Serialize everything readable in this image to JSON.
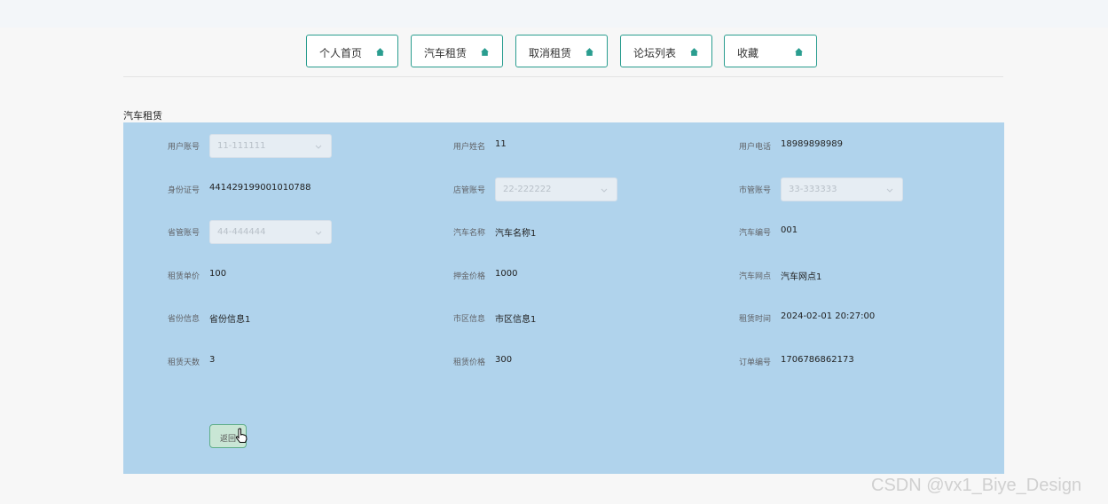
{
  "nav": {
    "items": [
      {
        "label": "个人首页"
      },
      {
        "label": "汽车租赁"
      },
      {
        "label": "取消租赁"
      },
      {
        "label": "论坛列表"
      },
      {
        "label": "收藏"
      }
    ]
  },
  "section_title": "汽车租赁",
  "form": {
    "user_account": {
      "label": "用户账号",
      "value": "11-111111"
    },
    "user_name": {
      "label": "用户姓名",
      "value": "11"
    },
    "user_phone": {
      "label": "用户电话",
      "value": "18989898989"
    },
    "id_number": {
      "label": "身份证号",
      "value": "441429199001010788"
    },
    "store_account": {
      "label": "店管账号",
      "value": "22-222222"
    },
    "city_account": {
      "label": "市管账号",
      "value": "33-333333"
    },
    "province_account": {
      "label": "省管账号",
      "value": "44-444444"
    },
    "car_name": {
      "label": "汽车名称",
      "value": "汽车名称1"
    },
    "car_number": {
      "label": "汽车编号",
      "value": "001"
    },
    "rent_unit_price": {
      "label": "租赁单价",
      "value": "100"
    },
    "deposit_price": {
      "label": "押金价格",
      "value": "1000"
    },
    "car_outlet": {
      "label": "汽车网点",
      "value": "汽车网点1"
    },
    "province_info": {
      "label": "省份信息",
      "value": "省份信息1"
    },
    "city_info": {
      "label": "市区信息",
      "value": "市区信息1"
    },
    "rent_time": {
      "label": "租赁时间",
      "value": "2024-02-01 20:27:00"
    },
    "rent_days": {
      "label": "租赁天数",
      "value": "3"
    },
    "rent_price": {
      "label": "租赁价格",
      "value": "300"
    },
    "order_number": {
      "label": "订单编号",
      "value": "1706786862173"
    }
  },
  "back_button": {
    "label": "返回"
  },
  "watermark": "CSDN @vx1_Biye_Design",
  "colors": {
    "panel": "#b0d3ec",
    "accent": "#2a9d8f",
    "background": "#f7f7f7"
  },
  "icons": {
    "nav": "home-icon",
    "select": "chevron-down-icon",
    "cursor": "hand-pointer-icon"
  }
}
